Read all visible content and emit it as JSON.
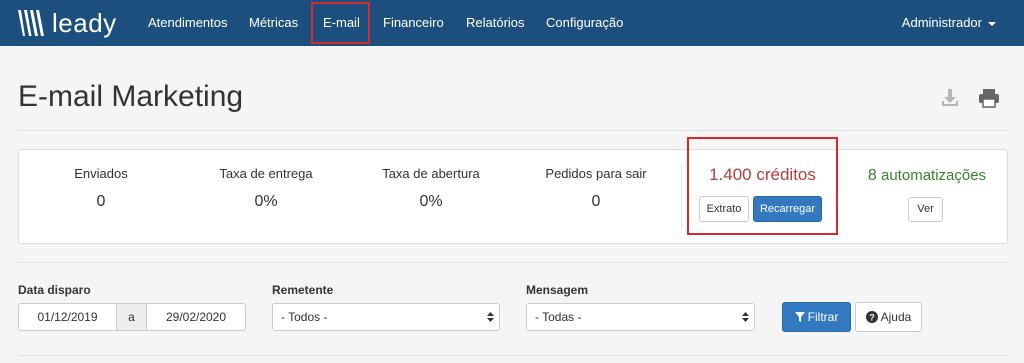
{
  "brand": {
    "name": "leady"
  },
  "nav": {
    "items": [
      "Atendimentos",
      "Métricas",
      "E-mail",
      "Financeiro",
      "Relatórios",
      "Configuração"
    ],
    "active": "E-mail",
    "user": "Administrador"
  },
  "page": {
    "title": "E-mail Marketing",
    "icons": [
      "download-icon",
      "print-icon"
    ]
  },
  "stats": [
    {
      "label": "Enviados",
      "value": "0"
    },
    {
      "label": "Taxa de entrega",
      "value": "0%"
    },
    {
      "label": "Taxa de abertura",
      "value": "0%"
    },
    {
      "label": "Pedidos para sair",
      "value": "0"
    }
  ],
  "credits": {
    "text": "1.400 créditos",
    "extract_label": "Extrato",
    "recharge_label": "Recarregar"
  },
  "automations": {
    "count": "8",
    "label": "automatizações",
    "view_label": "Ver"
  },
  "filters": {
    "date_label": "Data disparo",
    "date_from": "01/12/2019",
    "date_sep": "a",
    "date_to": "29/02/2020",
    "sender_label": "Remetente",
    "sender_value": "- Todos -",
    "message_label": "Mensagem",
    "message_value": "- Todas -",
    "filter_label": "Filtrar",
    "help_label": "Ajuda"
  },
  "colors": {
    "navbar": "#1c4f7d",
    "highlight": "#d7282e",
    "primary": "#3279c0",
    "credits": "#b63b3b",
    "automations": "#3c7f2f"
  }
}
